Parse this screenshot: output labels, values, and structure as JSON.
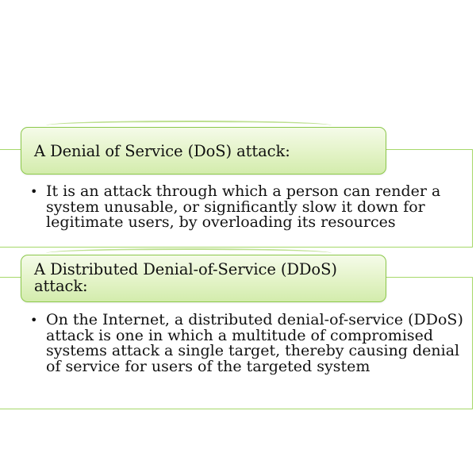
{
  "sections": [
    {
      "heading": "A Denial of Service (DoS) attack:",
      "bullet": "It is an attack through which a person can render a system unusable, or significantly slow it down for legitimate users, by overloading its resources"
    },
    {
      "heading": "A Distributed Denial-of-Service (DDoS) attack:",
      "bullet": "On the Internet, a distributed denial-of-service (DDoS) attack is one in which a multitude of compromised systems attack a single target, thereby causing denial of service for users of the targeted system"
    }
  ],
  "bullet_glyph": "•",
  "colors": {
    "box_border": "#a6d86a",
    "pill_border": "#8cc84b",
    "pill_fill_top": "#f5fbe9",
    "pill_fill_bottom": "#d3ecac",
    "text": "#111111"
  }
}
